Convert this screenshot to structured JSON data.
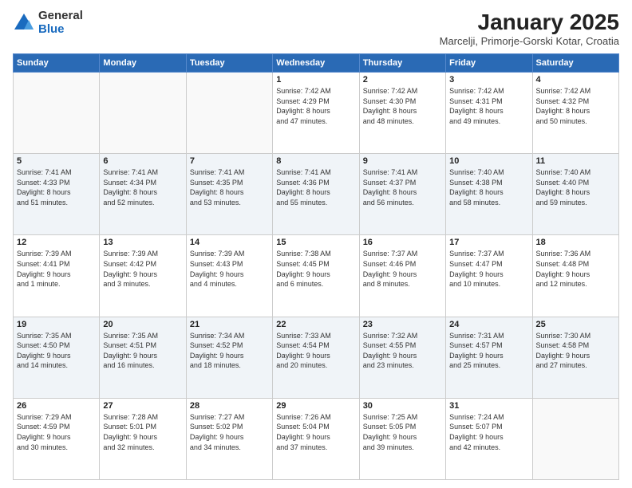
{
  "logo": {
    "general": "General",
    "blue": "Blue"
  },
  "title": "January 2025",
  "location": "Marcelji, Primorje-Gorski Kotar, Croatia",
  "days_of_week": [
    "Sunday",
    "Monday",
    "Tuesday",
    "Wednesday",
    "Thursday",
    "Friday",
    "Saturday"
  ],
  "weeks": [
    [
      {
        "day": "",
        "info": ""
      },
      {
        "day": "",
        "info": ""
      },
      {
        "day": "",
        "info": ""
      },
      {
        "day": "1",
        "info": "Sunrise: 7:42 AM\nSunset: 4:29 PM\nDaylight: 8 hours\nand 47 minutes."
      },
      {
        "day": "2",
        "info": "Sunrise: 7:42 AM\nSunset: 4:30 PM\nDaylight: 8 hours\nand 48 minutes."
      },
      {
        "day": "3",
        "info": "Sunrise: 7:42 AM\nSunset: 4:31 PM\nDaylight: 8 hours\nand 49 minutes."
      },
      {
        "day": "4",
        "info": "Sunrise: 7:42 AM\nSunset: 4:32 PM\nDaylight: 8 hours\nand 50 minutes."
      }
    ],
    [
      {
        "day": "5",
        "info": "Sunrise: 7:41 AM\nSunset: 4:33 PM\nDaylight: 8 hours\nand 51 minutes."
      },
      {
        "day": "6",
        "info": "Sunrise: 7:41 AM\nSunset: 4:34 PM\nDaylight: 8 hours\nand 52 minutes."
      },
      {
        "day": "7",
        "info": "Sunrise: 7:41 AM\nSunset: 4:35 PM\nDaylight: 8 hours\nand 53 minutes."
      },
      {
        "day": "8",
        "info": "Sunrise: 7:41 AM\nSunset: 4:36 PM\nDaylight: 8 hours\nand 55 minutes."
      },
      {
        "day": "9",
        "info": "Sunrise: 7:41 AM\nSunset: 4:37 PM\nDaylight: 8 hours\nand 56 minutes."
      },
      {
        "day": "10",
        "info": "Sunrise: 7:40 AM\nSunset: 4:38 PM\nDaylight: 8 hours\nand 58 minutes."
      },
      {
        "day": "11",
        "info": "Sunrise: 7:40 AM\nSunset: 4:40 PM\nDaylight: 8 hours\nand 59 minutes."
      }
    ],
    [
      {
        "day": "12",
        "info": "Sunrise: 7:39 AM\nSunset: 4:41 PM\nDaylight: 9 hours\nand 1 minute."
      },
      {
        "day": "13",
        "info": "Sunrise: 7:39 AM\nSunset: 4:42 PM\nDaylight: 9 hours\nand 3 minutes."
      },
      {
        "day": "14",
        "info": "Sunrise: 7:39 AM\nSunset: 4:43 PM\nDaylight: 9 hours\nand 4 minutes."
      },
      {
        "day": "15",
        "info": "Sunrise: 7:38 AM\nSunset: 4:45 PM\nDaylight: 9 hours\nand 6 minutes."
      },
      {
        "day": "16",
        "info": "Sunrise: 7:37 AM\nSunset: 4:46 PM\nDaylight: 9 hours\nand 8 minutes."
      },
      {
        "day": "17",
        "info": "Sunrise: 7:37 AM\nSunset: 4:47 PM\nDaylight: 9 hours\nand 10 minutes."
      },
      {
        "day": "18",
        "info": "Sunrise: 7:36 AM\nSunset: 4:48 PM\nDaylight: 9 hours\nand 12 minutes."
      }
    ],
    [
      {
        "day": "19",
        "info": "Sunrise: 7:35 AM\nSunset: 4:50 PM\nDaylight: 9 hours\nand 14 minutes."
      },
      {
        "day": "20",
        "info": "Sunrise: 7:35 AM\nSunset: 4:51 PM\nDaylight: 9 hours\nand 16 minutes."
      },
      {
        "day": "21",
        "info": "Sunrise: 7:34 AM\nSunset: 4:52 PM\nDaylight: 9 hours\nand 18 minutes."
      },
      {
        "day": "22",
        "info": "Sunrise: 7:33 AM\nSunset: 4:54 PM\nDaylight: 9 hours\nand 20 minutes."
      },
      {
        "day": "23",
        "info": "Sunrise: 7:32 AM\nSunset: 4:55 PM\nDaylight: 9 hours\nand 23 minutes."
      },
      {
        "day": "24",
        "info": "Sunrise: 7:31 AM\nSunset: 4:57 PM\nDaylight: 9 hours\nand 25 minutes."
      },
      {
        "day": "25",
        "info": "Sunrise: 7:30 AM\nSunset: 4:58 PM\nDaylight: 9 hours\nand 27 minutes."
      }
    ],
    [
      {
        "day": "26",
        "info": "Sunrise: 7:29 AM\nSunset: 4:59 PM\nDaylight: 9 hours\nand 30 minutes."
      },
      {
        "day": "27",
        "info": "Sunrise: 7:28 AM\nSunset: 5:01 PM\nDaylight: 9 hours\nand 32 minutes."
      },
      {
        "day": "28",
        "info": "Sunrise: 7:27 AM\nSunset: 5:02 PM\nDaylight: 9 hours\nand 34 minutes."
      },
      {
        "day": "29",
        "info": "Sunrise: 7:26 AM\nSunset: 5:04 PM\nDaylight: 9 hours\nand 37 minutes."
      },
      {
        "day": "30",
        "info": "Sunrise: 7:25 AM\nSunset: 5:05 PM\nDaylight: 9 hours\nand 39 minutes."
      },
      {
        "day": "31",
        "info": "Sunrise: 7:24 AM\nSunset: 5:07 PM\nDaylight: 9 hours\nand 42 minutes."
      },
      {
        "day": "",
        "info": ""
      }
    ]
  ]
}
